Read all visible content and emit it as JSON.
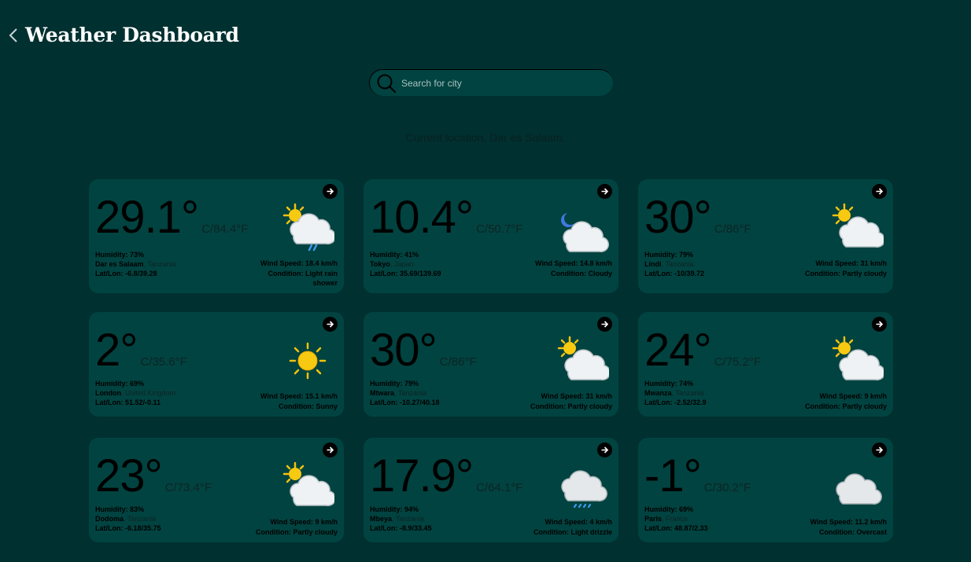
{
  "app": {
    "title": "Weather Dashboard"
  },
  "search": {
    "placeholder": "Search for city",
    "value": ""
  },
  "location_text": "Current location, Dar es Salaam.",
  "labels": {
    "humidity": "Humidity:",
    "latlon": "Lat/Lon:",
    "wind": "Wind Speed:",
    "condition": "Condition:"
  },
  "cards": [
    {
      "temp_c": "29.1°",
      "temp_f": "C/84.4°F",
      "humidity": "73%",
      "city": "Dar es Salaam",
      "country": ", Tanzania",
      "latlon": "-6.8/39.28",
      "wind": "18.4 km/h",
      "condition": "Light rain shower",
      "icon": "sun-cloud-rain-icon"
    },
    {
      "temp_c": "10.4°",
      "temp_f": "C/50.7°F",
      "humidity": "41%",
      "city": "Tokyo",
      "country": ", Japan",
      "latlon": "35.69/139.69",
      "wind": "14.8 km/h",
      "condition": "Cloudy",
      "icon": "moon-cloud-icon"
    },
    {
      "temp_c": "30°",
      "temp_f": "C/86°F",
      "humidity": "79%",
      "city": "Lindi",
      "country": ", Tanzania",
      "latlon": "-10/39.72",
      "wind": "31 km/h",
      "condition": "Partly cloudy",
      "icon": "partly-cloudy-icon"
    },
    {
      "temp_c": "2°",
      "temp_f": "C/35.6°F",
      "humidity": "69%",
      "city": "London",
      "country": ", United Kingdom",
      "latlon": "51.52/-0.11",
      "wind": "15.1 km/h",
      "condition": "Sunny",
      "icon": "sun-icon"
    },
    {
      "temp_c": "30°",
      "temp_f": "C/86°F",
      "humidity": "79%",
      "city": "Mtwara",
      "country": ", Tanzania",
      "latlon": "-10.27/40.18",
      "wind": "31 km/h",
      "condition": "Partly cloudy",
      "icon": "partly-cloudy-icon"
    },
    {
      "temp_c": "24°",
      "temp_f": "C/75.2°F",
      "humidity": "74%",
      "city": "Mwanza",
      "country": ", Tanzania",
      "latlon": "-2.52/32.9",
      "wind": "9 km/h",
      "condition": "Partly cloudy",
      "icon": "partly-cloudy-icon"
    },
    {
      "temp_c": "23°",
      "temp_f": "C/73.4°F",
      "humidity": "83%",
      "city": "Dodoma",
      "country": ", Tanzania",
      "latlon": "-6.18/35.75",
      "wind": "9 km/h",
      "condition": "Partly cloudy",
      "icon": "partly-cloudy-icon"
    },
    {
      "temp_c": "17.9°",
      "temp_f": "C/64.1°F",
      "humidity": "94%",
      "city": "Mbeya",
      "country": ", Tanzania",
      "latlon": "-8.9/33.45",
      "wind": "4 km/h",
      "condition": "Light drizzle",
      "icon": "cloud-drizzle-icon"
    },
    {
      "temp_c": "-1°",
      "temp_f": "C/30.2°F",
      "humidity": "69%",
      "city": "Paris",
      "country": ", France",
      "latlon": "48.87/2.33",
      "wind": "11.2 km/h",
      "condition": "Overcast",
      "icon": "overcast-cloud-icon"
    }
  ],
  "colors": {
    "background": "#003030",
    "card": "#014340",
    "title": "#ffffff"
  }
}
